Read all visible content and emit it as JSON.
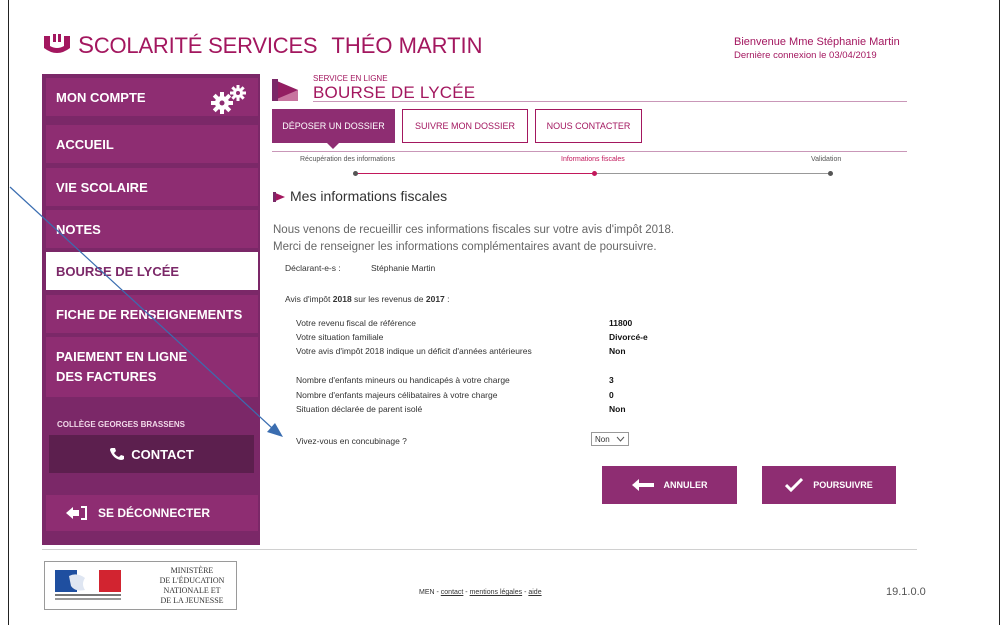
{
  "header": {
    "brand_first": "S",
    "brand_rest": "COLARITÉ SERVICES",
    "school": "THÉO MARTIN",
    "welcome": "Bienvenue Mme Stéphanie Martin",
    "last_login": "Dernière connexion le 03/04/2019"
  },
  "sidebar": {
    "items": [
      {
        "label": "MON COMPTE"
      },
      {
        "label": "ACCUEIL"
      },
      {
        "label": "VIE SCOLAIRE"
      },
      {
        "label": "NOTES"
      },
      {
        "label": "BOURSE DE LYCÉE"
      },
      {
        "label": "FICHE DE RENSEIGNEMENTS"
      },
      {
        "label": "PAIEMENT EN LIGNE DES FACTURES"
      }
    ],
    "college": "COLLÈGE GEORGES BRASSENS",
    "contact": "CONTACT",
    "logout": "SE DÉCONNECTER"
  },
  "service": {
    "kicker": "SERVICE EN LIGNE",
    "title": "BOURSE DE LYCÉE"
  },
  "tabs": [
    {
      "label": "DÉPOSER UN DOSSIER"
    },
    {
      "label": "SUIVRE MON DOSSIER"
    },
    {
      "label": "NOUS CONTACTER"
    }
  ],
  "steps": [
    {
      "label": "Récupération des informations"
    },
    {
      "label": "Informations fiscales"
    },
    {
      "label": "Validation"
    }
  ],
  "section": {
    "title": "Mes informations fiscales",
    "intro_1": "Nous venons de recueillir ces informations fiscales sur votre avis d'impôt 2018.",
    "intro_2": "Merci de renseigner les informations complémentaires avant de poursuivre."
  },
  "declarant": {
    "label": "Déclarant-e-s :",
    "name": "Stéphanie Martin"
  },
  "avis": {
    "pre": "Avis d'impôt ",
    "year1": "2018",
    "mid": " sur les revenus de ",
    "year2": "2017",
    "post": " :"
  },
  "fiscal_rows": [
    {
      "label": "Votre revenu fiscal de référence",
      "value": "11800"
    },
    {
      "label": "Votre situation familiale",
      "value": "Divorcé-e"
    },
    {
      "label": "Votre avis d'impôt 2018 indique un déficit d'années antérieures",
      "value": "Non"
    },
    {
      "label": "Nombre d'enfants mineurs ou handicapés à votre charge",
      "value": "3"
    },
    {
      "label": "Nombre d'enfants majeurs célibataires à votre charge",
      "value": "0"
    },
    {
      "label": "Situation déclarée de parent isolé",
      "value": "Non"
    }
  ],
  "concubinage": {
    "question": "Vivez-vous en concubinage ?",
    "selected": "Non"
  },
  "buttons": {
    "cancel": "ANNULER",
    "continue": "POURSUIVRE"
  },
  "footer": {
    "ministry_1": "MINISTÈRE",
    "ministry_2": "DE L'ÉDUCATION",
    "ministry_3": "NATIONALE ET",
    "ministry_4": "DE LA JEUNESSE",
    "men": "MEN - ",
    "contact": "contact",
    "sep1": " - ",
    "legal": "mentions légales",
    "sep2": " - ",
    "help": "aide",
    "version": "19.1.0.0"
  },
  "colors": {
    "brand": "#a3175f",
    "sidebar": "#7b2868",
    "nav_item": "#8e2d72",
    "accent_pink": "#c2185b"
  }
}
